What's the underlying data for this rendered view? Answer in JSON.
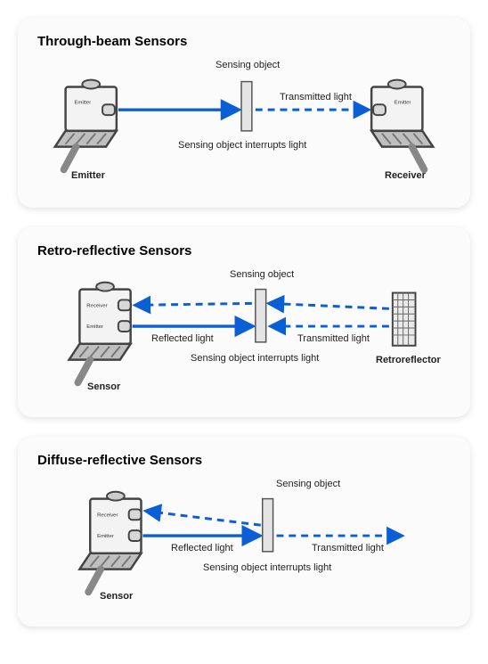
{
  "panels": [
    {
      "title": "Through-beam Sensors",
      "labels": {
        "top_center": "Sensing object",
        "right_mid": "Transmitted light",
        "bottom_center": "Sensing object interrupts light",
        "left_device": "Emitter",
        "right_device": "Receiver",
        "left_lens": "Emitter",
        "right_lens": "Emitter"
      }
    },
    {
      "title": "Retro-reflective Sensors",
      "labels": {
        "top_center": "Sensing object",
        "left_mid": "Reflected light",
        "right_mid": "Transmitted light",
        "bottom_center": "Sensing object interrupts light",
        "left_device": "Sensor",
        "right_device": "Retroreflector",
        "lens_top": "Receiver",
        "lens_bottom": "Emitter"
      }
    },
    {
      "title": "Diffuse-reflective Sensors",
      "labels": {
        "top_center": "Sensing object",
        "left_mid": "Reflected light",
        "right_mid": "Transmitted light",
        "bottom_center": "Sensing object interrupts light",
        "left_device": "Sensor",
        "lens_top": "Receiver",
        "lens_bottom": "Emitter"
      }
    }
  ]
}
